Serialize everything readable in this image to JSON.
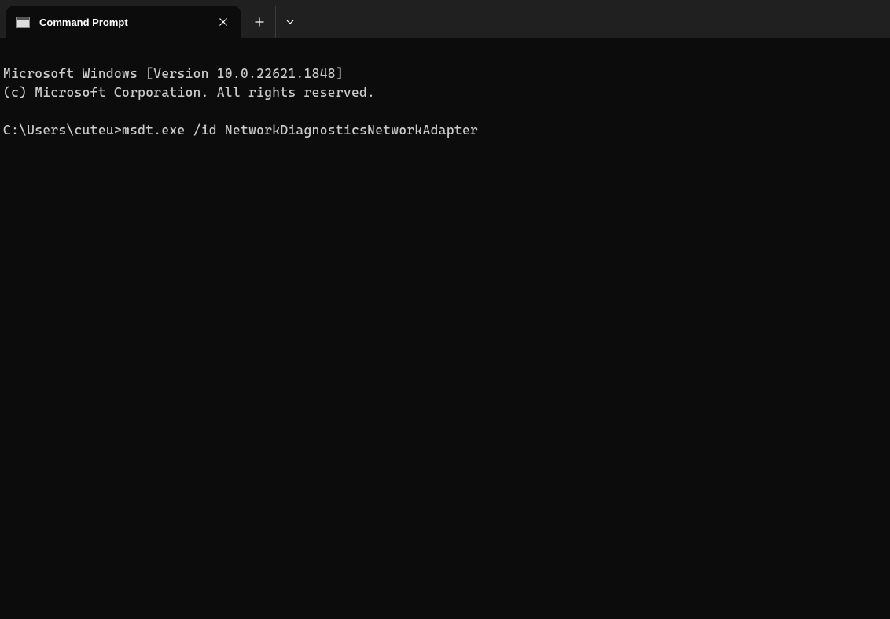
{
  "titlebar": {
    "tab_title": "Command Prompt"
  },
  "terminal": {
    "line1": "Microsoft Windows [Version 10.0.22621.1848]",
    "line2": "(c) Microsoft Corporation. All rights reserved.",
    "blank": "",
    "prompt": "C:\\Users\\cuteu>",
    "command": "msdt.exe /id NetworkDiagnosticsNetworkAdapter"
  }
}
